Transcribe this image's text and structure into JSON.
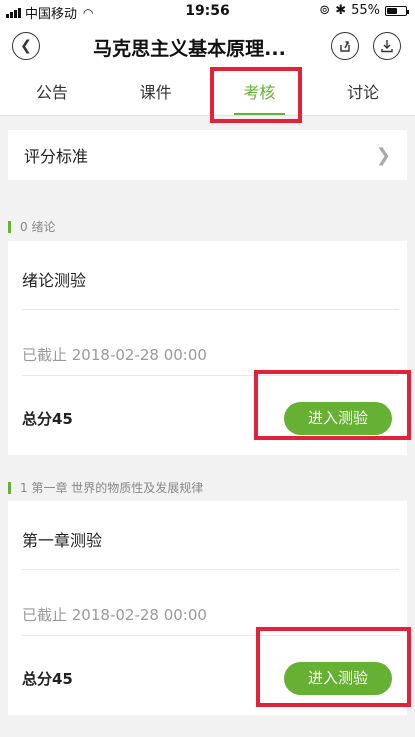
{
  "status_bar": {
    "carrier": "中国移动",
    "time": "19:56",
    "battery": "55%",
    "battery_level": 0.55
  },
  "nav": {
    "title": "马克思主义基本原理..."
  },
  "tabs": [
    {
      "label": "公告",
      "active": false
    },
    {
      "label": "课件",
      "active": false
    },
    {
      "label": "考核",
      "active": true
    },
    {
      "label": "讨论",
      "active": false
    }
  ],
  "scoring": {
    "label": "评分标准"
  },
  "sections": [
    {
      "header": "0 绪论",
      "card": {
        "title": "绪论测验",
        "deadline": "已截止 2018-02-28 00:00",
        "total": "总分45",
        "button": "进入测验"
      }
    },
    {
      "header": "1  第一章  世界的物质性及发展规律",
      "card": {
        "title": "第一章测验",
        "deadline": "已截止 2018-02-28 00:00",
        "total": "总分45",
        "button": "进入测验"
      }
    }
  ],
  "colors": {
    "accent": "#66b034",
    "highlight": "#e2213a",
    "background": "#f2f2f2"
  },
  "icons": {
    "back": "chevron-left-icon",
    "share": "share-icon",
    "download": "download-icon",
    "chevron": "chevron-right-icon"
  }
}
